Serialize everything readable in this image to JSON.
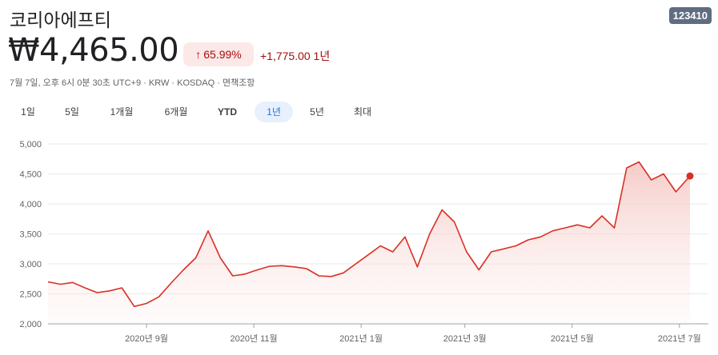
{
  "title": "코리아에프티",
  "ticker": "123410",
  "price": "₩4,465.00",
  "change_pct": "65.99%",
  "change_arrow": "↑",
  "change_abs": "+1,775.00 1년",
  "meta": "7월 7일, 오후 6시 0분 30초 UTC+9 · KRW · KOSDAQ · 면책조항",
  "tabs": [
    {
      "label": "1일",
      "active": false
    },
    {
      "label": "5일",
      "active": false
    },
    {
      "label": "1개월",
      "active": false
    },
    {
      "label": "6개월",
      "active": false
    },
    {
      "label": "YTD",
      "active": false
    },
    {
      "label": "1년",
      "active": true
    },
    {
      "label": "5년",
      "active": false
    },
    {
      "label": "최대",
      "active": false
    }
  ],
  "colors": {
    "line": "#d93025",
    "fill_top": "#f4c7c3",
    "badge": "#5f6c82",
    "active_tab": "#1a73e8"
  },
  "chart_data": {
    "type": "area",
    "ylim": [
      2000,
      5000
    ],
    "yticks": [
      2000,
      2500,
      3000,
      3500,
      4000,
      4500,
      5000
    ],
    "ytick_labels": [
      "2,000",
      "2,500",
      "3,000",
      "3,500",
      "4,000",
      "4,500",
      "5,000"
    ],
    "xticks": [
      "2020년 9월",
      "2020년 11월",
      "2021년 1월",
      "2021년 3월",
      "2021년 5월",
      "2021년 7월"
    ],
    "xtick_dates": [
      "2020-09-01",
      "2020-11-01",
      "2021-01-01",
      "2021-03-01",
      "2021-05-01",
      "2021-07-01"
    ],
    "xlim": [
      "2020-07-07",
      "2021-07-07"
    ],
    "grid": true,
    "series": [
      {
        "values": [
          [
            "2020-07-07",
            2700
          ],
          [
            "2020-07-14",
            2660
          ],
          [
            "2020-07-21",
            2690
          ],
          [
            "2020-07-28",
            2600
          ],
          [
            "2020-08-04",
            2520
          ],
          [
            "2020-08-11",
            2550
          ],
          [
            "2020-08-18",
            2600
          ],
          [
            "2020-08-25",
            2290
          ],
          [
            "2020-09-01",
            2340
          ],
          [
            "2020-09-08",
            2450
          ],
          [
            "2020-09-15",
            2680
          ],
          [
            "2020-09-22",
            2900
          ],
          [
            "2020-09-29",
            3100
          ],
          [
            "2020-10-06",
            3550
          ],
          [
            "2020-10-13",
            3100
          ],
          [
            "2020-10-20",
            2800
          ],
          [
            "2020-10-27",
            2830
          ],
          [
            "2020-11-03",
            2900
          ],
          [
            "2020-11-10",
            2960
          ],
          [
            "2020-11-17",
            2970
          ],
          [
            "2020-11-24",
            2950
          ],
          [
            "2020-12-01",
            2920
          ],
          [
            "2020-12-08",
            2800
          ],
          [
            "2020-12-15",
            2790
          ],
          [
            "2020-12-22",
            2850
          ],
          [
            "2020-12-29",
            3000
          ],
          [
            "2021-01-05",
            3150
          ],
          [
            "2021-01-12",
            3300
          ],
          [
            "2021-01-19",
            3200
          ],
          [
            "2021-01-26",
            3450
          ],
          [
            "2021-02-02",
            2950
          ],
          [
            "2021-02-09",
            3500
          ],
          [
            "2021-02-16",
            3900
          ],
          [
            "2021-02-23",
            3700
          ],
          [
            "2021-03-02",
            3200
          ],
          [
            "2021-03-09",
            2900
          ],
          [
            "2021-03-16",
            3200
          ],
          [
            "2021-03-23",
            3250
          ],
          [
            "2021-03-30",
            3300
          ],
          [
            "2021-04-06",
            3400
          ],
          [
            "2021-04-13",
            3450
          ],
          [
            "2021-04-20",
            3550
          ],
          [
            "2021-04-27",
            3600
          ],
          [
            "2021-05-04",
            3650
          ],
          [
            "2021-05-11",
            3600
          ],
          [
            "2021-05-18",
            3800
          ],
          [
            "2021-05-25",
            3600
          ],
          [
            "2021-06-01",
            4600
          ],
          [
            "2021-06-08",
            4700
          ],
          [
            "2021-06-15",
            4400
          ],
          [
            "2021-06-22",
            4500
          ],
          [
            "2021-06-29",
            4200
          ],
          [
            "2021-07-07",
            4465
          ]
        ]
      }
    ]
  }
}
